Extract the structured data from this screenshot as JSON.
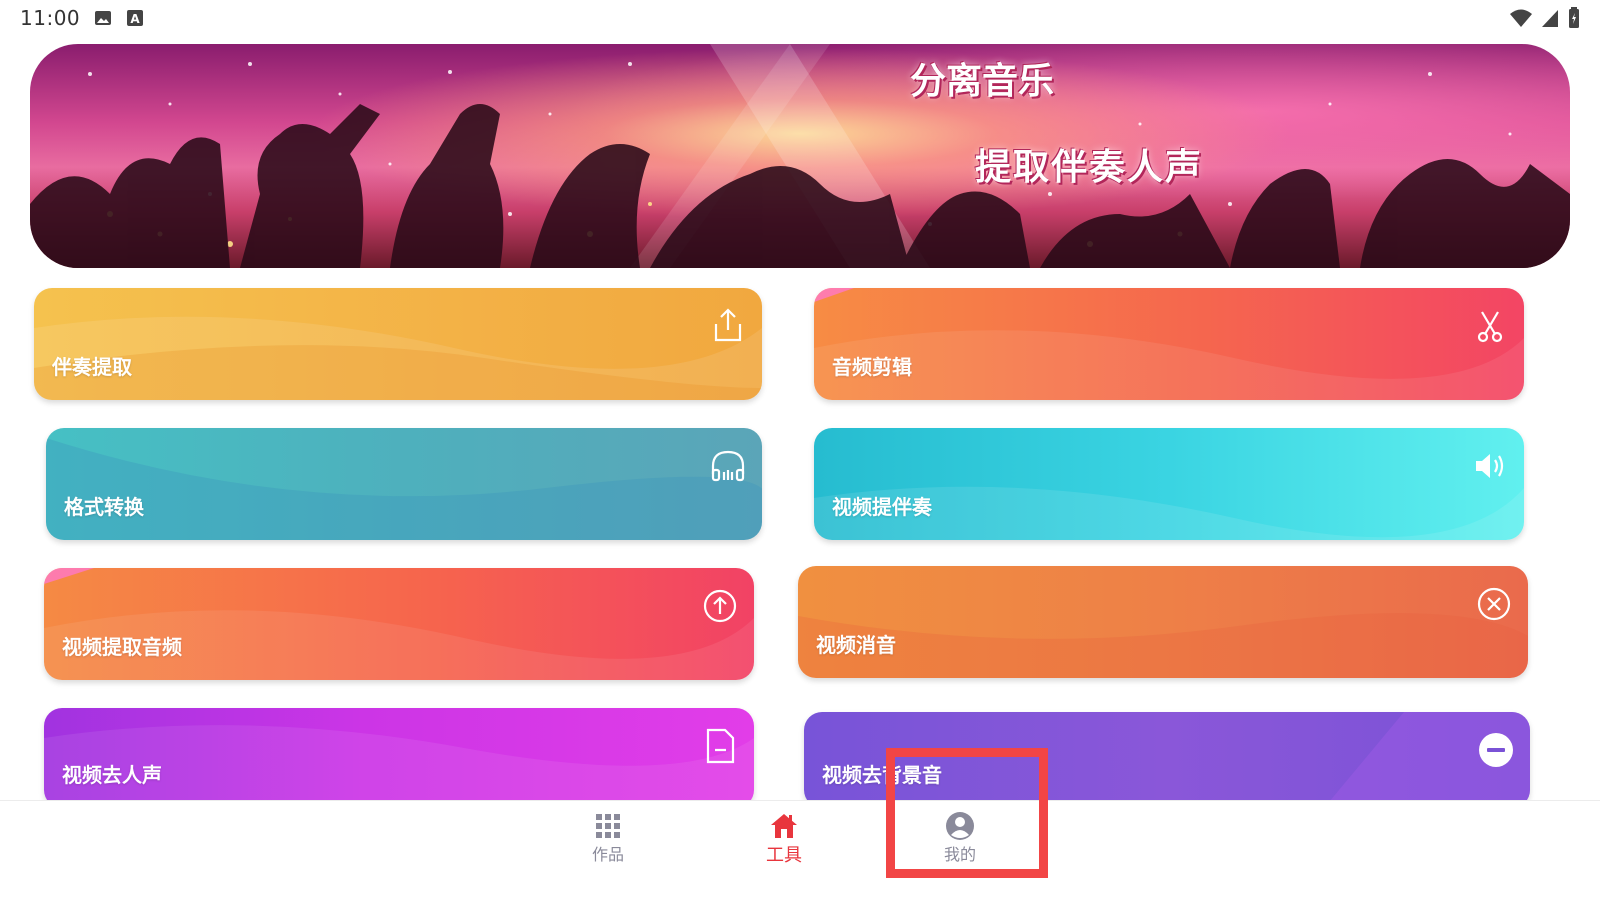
{
  "status_bar": {
    "time": "11:00",
    "icons": [
      "image-icon",
      "a-badge-icon",
      "wifi-icon",
      "signal-icon",
      "battery-icon"
    ]
  },
  "banner": {
    "title": "分离音乐",
    "subtitle": "提取伴奏人声"
  },
  "tools": [
    {
      "label": "伴奏提取",
      "icon": "share-upload-icon"
    },
    {
      "label": "音频剪辑",
      "icon": "scissors-icon"
    },
    {
      "label": "格式转换",
      "icon": "headphones-icon"
    },
    {
      "label": "视频提伴奏",
      "icon": "speaker-icon"
    },
    {
      "label": "视频提取音频",
      "icon": "circle-up-arrow-icon"
    },
    {
      "label": "视频消音",
      "icon": "circle-x-icon"
    },
    {
      "label": "视频去人声",
      "icon": "document-minus-icon"
    },
    {
      "label": "视频去背景音",
      "icon": "circle-minus-icon"
    }
  ],
  "bottom_nav": {
    "items": [
      {
        "label": "作品",
        "icon": "grid-icon",
        "active": false
      },
      {
        "label": "工具",
        "icon": "home-icon",
        "active": true
      },
      {
        "label": "我的",
        "icon": "user-icon",
        "active": false
      }
    ]
  },
  "colors": {
    "active_nav": "#e8353d",
    "inactive_nav": "#8a8a9a",
    "highlight": "#f24545"
  }
}
